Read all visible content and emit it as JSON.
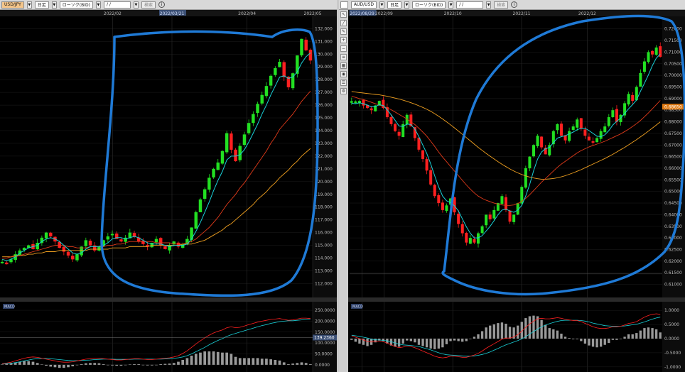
{
  "toolbar_left": {
    "symbol": "USD/JPY",
    "period": "日足",
    "chart_type": "ローソク(BID)",
    "date": " /  / ",
    "search_label": "検索"
  },
  "toolbar_right": {
    "symbol": "AUD/USD",
    "period": "日足",
    "chart_type": "ローソク(BID)",
    "date": " /  / ",
    "search_label": "検索"
  },
  "icons": {
    "info": "info-icon",
    "tools": [
      "cursor-icon",
      "line-icon",
      "pencil-icon",
      "zoom-in-icon",
      "zoom-out-icon",
      "fibonacci-icon",
      "grid-icon",
      "eye-icon",
      "layers-icon",
      "settings-icon"
    ]
  },
  "colors": {
    "bull": "#22e022",
    "bear": "#ff2020",
    "ma_short": "#19cfd6",
    "ma_mid": "#e03a1a",
    "ma_long": "#f0a020",
    "annotation": "#1f7ad6",
    "macd_hist": "#9a9a9a"
  },
  "chart_data": [
    {
      "type": "candlestick",
      "panel": "left",
      "symbol": "USD/JPY",
      "x_ticks": [
        "2022/02",
        "2022/03/21",
        "2022/04",
        "2022/05"
      ],
      "highlighted_date": "2022/03/21",
      "ylim": [
        111.3,
        132.8
      ],
      "y_ticks": [
        "112.000",
        "113.000",
        "114.000",
        "115.000",
        "116.000",
        "117.000",
        "118.000",
        "119.000",
        "120.000",
        "121.000",
        "122.000",
        "123.000",
        "124.000",
        "125.000",
        "126.000",
        "127.000",
        "128.000",
        "129.000",
        "130.000",
        "131.000",
        "132.000"
      ],
      "y_tick_values": [
        112,
        113,
        114,
        115,
        116,
        117,
        118,
        119,
        120,
        121,
        122,
        123,
        124,
        125,
        126,
        127,
        128,
        129,
        130,
        131,
        132
      ],
      "close_path": [
        113.7,
        113.6,
        113.9,
        114.3,
        114.6,
        114.8,
        115.0,
        114.7,
        115.2,
        115.6,
        116.0,
        115.7,
        115.3,
        114.8,
        114.5,
        114.2,
        113.9,
        114.3,
        114.9,
        115.4,
        115.0,
        114.6,
        114.9,
        115.4,
        115.7,
        115.9,
        115.5,
        115.3,
        115.6,
        116.0,
        115.7,
        115.3,
        115.1,
        114.9,
        115.2,
        115.5,
        115.0,
        114.7,
        115.0,
        115.3,
        114.9,
        115.1,
        115.5,
        116.4,
        117.6,
        118.6,
        119.4,
        120.3,
        121.0,
        121.5,
        122.4,
        123.8,
        122.5,
        121.6,
        122.8,
        123.7,
        124.6,
        125.3,
        126.1,
        126.8,
        127.5,
        128.3,
        128.9,
        129.4,
        128.2,
        127.4,
        128.5,
        129.9,
        131.2,
        130.3,
        129.5
      ],
      "ma_short": [
        113.9,
        113.8,
        113.9,
        114.1,
        114.4,
        114.6,
        114.8,
        114.9,
        115.0,
        115.3,
        115.5,
        115.6,
        115.5,
        115.3,
        115.0,
        114.7,
        114.4,
        114.3,
        114.4,
        114.7,
        114.9,
        114.9,
        114.9,
        115.0,
        115.2,
        115.5,
        115.6,
        115.6,
        115.5,
        115.6,
        115.7,
        115.6,
        115.4,
        115.2,
        115.1,
        115.1,
        115.1,
        115.0,
        114.9,
        115.0,
        115.0,
        115.0,
        115.1,
        115.5,
        116.1,
        116.8,
        117.6,
        118.4,
        119.3,
        120.1,
        120.8,
        121.7,
        122.0,
        122.0,
        122.1,
        122.5,
        123.1,
        123.8,
        124.5,
        125.3,
        126.0,
        126.8,
        127.5,
        128.2,
        128.3,
        128.1,
        128.2,
        128.6,
        129.3,
        129.8,
        130.1
      ],
      "ma_mid": [
        114.0,
        114.0,
        114.1,
        114.1,
        114.2,
        114.3,
        114.4,
        114.5,
        114.6,
        114.7,
        114.8,
        114.9,
        115.0,
        115.0,
        115.0,
        114.9,
        114.9,
        114.8,
        114.8,
        114.8,
        114.9,
        114.9,
        114.9,
        114.9,
        115.0,
        115.0,
        115.1,
        115.1,
        115.2,
        115.3,
        115.3,
        115.3,
        115.3,
        115.3,
        115.3,
        115.2,
        115.2,
        115.2,
        115.2,
        115.1,
        115.1,
        115.1,
        115.2,
        115.3,
        115.5,
        115.8,
        116.1,
        116.4,
        116.8,
        117.2,
        117.7,
        118.2,
        118.6,
        119.0,
        119.5,
        119.9,
        120.4,
        120.9,
        121.4,
        121.9,
        122.4,
        123.0,
        123.5,
        124.1,
        124.5,
        124.9,
        125.3,
        125.8,
        126.3,
        126.7,
        127.1
      ],
      "ma_long": [
        114.1,
        114.1,
        114.1,
        114.2,
        114.2,
        114.2,
        114.3,
        114.3,
        114.4,
        114.4,
        114.5,
        114.5,
        114.5,
        114.6,
        114.6,
        114.6,
        114.6,
        114.6,
        114.6,
        114.6,
        114.7,
        114.7,
        114.7,
        114.7,
        114.7,
        114.8,
        114.8,
        114.8,
        114.8,
        114.9,
        114.9,
        114.9,
        114.9,
        114.9,
        115.0,
        115.0,
        115.0,
        115.0,
        115.0,
        115.0,
        115.0,
        115.1,
        115.1,
        115.1,
        115.2,
        115.3,
        115.4,
        115.6,
        115.8,
        116.0,
        116.2,
        116.5,
        116.7,
        117.0,
        117.3,
        117.6,
        117.9,
        118.2,
        118.6,
        118.9,
        119.2,
        119.6,
        119.9,
        120.3,
        120.6,
        120.9,
        121.3,
        121.6,
        122.0,
        122.3,
        122.6
      ],
      "macd": {
        "label": "MACD",
        "ylim": [
          -20,
          260
        ],
        "y_ticks": [
          "0.0000",
          "50.0000",
          "100.0000",
          "150.0000",
          "200.0000",
          "250.0000"
        ],
        "y_tick_values": [
          0,
          50,
          100,
          150,
          200,
          250
        ],
        "current_label": "139.2360",
        "current_value": 125,
        "macd_line": [
          5,
          8,
          12,
          18,
          24,
          30,
          34,
          36,
          34,
          30,
          26,
          22,
          18,
          14,
          12,
          12,
          14,
          18,
          22,
          26,
          28,
          30,
          30,
          28,
          26,
          24,
          22,
          22,
          24,
          26,
          28,
          28,
          26,
          24,
          24,
          26,
          28,
          30,
          32,
          36,
          42,
          52,
          64,
          80,
          96,
          110,
          124,
          136,
          146,
          154,
          160,
          170,
          174,
          170,
          172,
          178,
          184,
          190,
          196,
          200,
          204,
          208,
          210,
          212,
          208,
          204,
          206,
          210,
          214,
          214,
          212
        ],
        "signal_line": [
          4,
          5,
          7,
          10,
          14,
          18,
          22,
          26,
          28,
          29,
          29,
          28,
          26,
          24,
          22,
          20,
          19,
          19,
          20,
          21,
          22,
          24,
          25,
          26,
          26,
          26,
          25,
          25,
          25,
          25,
          26,
          26,
          26,
          26,
          26,
          26,
          26,
          27,
          28,
          30,
          32,
          36,
          42,
          50,
          60,
          70,
          80,
          92,
          102,
          112,
          120,
          130,
          138,
          144,
          150,
          156,
          162,
          168,
          174,
          180,
          184,
          190,
          194,
          198,
          200,
          202,
          202,
          204,
          206,
          208,
          210
        ]
      }
    },
    {
      "type": "candlestick",
      "panel": "right",
      "symbol": "AUD/USD",
      "x_ticks": [
        "2022/08/29",
        "2022/09",
        "2022/10",
        "2022/11",
        "2022/12"
      ],
      "highlighted_date": "2022/08/29",
      "ylim": [
        0.6065,
        0.7245
      ],
      "y_ticks": [
        "0.61000",
        "0.61500",
        "0.62000",
        "0.62500",
        "0.63000",
        "0.63500",
        "0.64000",
        "0.64500",
        "0.65000",
        "0.65500",
        "0.66000",
        "0.66500",
        "0.67000",
        "0.67500",
        "0.68000",
        "0.68500",
        "0.69000",
        "0.69500",
        "0.70000",
        "0.70500",
        "0.71000",
        "0.71500",
        "0.72000"
      ],
      "y_tick_values": [
        0.61,
        0.615,
        0.62,
        0.625,
        0.63,
        0.635,
        0.64,
        0.645,
        0.65,
        0.655,
        0.66,
        0.665,
        0.67,
        0.675,
        0.68,
        0.685,
        0.69,
        0.695,
        0.7,
        0.705,
        0.71,
        0.715,
        0.72
      ],
      "current_label": "0.68650",
      "current_value": 0.6865,
      "close_path": [
        0.6885,
        0.688,
        0.689,
        0.687,
        0.686,
        0.685,
        0.687,
        0.689,
        0.686,
        0.682,
        0.679,
        0.676,
        0.674,
        0.679,
        0.683,
        0.678,
        0.673,
        0.668,
        0.664,
        0.659,
        0.653,
        0.648,
        0.645,
        0.642,
        0.644,
        0.647,
        0.641,
        0.636,
        0.632,
        0.628,
        0.63,
        0.628,
        0.632,
        0.635,
        0.64,
        0.638,
        0.642,
        0.645,
        0.648,
        0.642,
        0.637,
        0.64,
        0.645,
        0.652,
        0.66,
        0.665,
        0.67,
        0.674,
        0.669,
        0.666,
        0.67,
        0.676,
        0.679,
        0.674,
        0.672,
        0.676,
        0.678,
        0.681,
        0.677,
        0.674,
        0.672,
        0.671,
        0.673,
        0.676,
        0.678,
        0.682,
        0.685,
        0.68,
        0.683,
        0.688,
        0.692,
        0.689,
        0.695,
        0.701,
        0.706,
        0.71,
        0.709,
        0.712,
        0.708
      ],
      "ma_short": [
        0.688,
        0.6878,
        0.6882,
        0.6878,
        0.6872,
        0.6864,
        0.6866,
        0.6874,
        0.687,
        0.6852,
        0.683,
        0.6806,
        0.6782,
        0.678,
        0.679,
        0.6788,
        0.6768,
        0.6736,
        0.67,
        0.6664,
        0.6618,
        0.6568,
        0.652,
        0.648,
        0.646,
        0.6452,
        0.6438,
        0.6416,
        0.6382,
        0.6348,
        0.632,
        0.63,
        0.63,
        0.631,
        0.633,
        0.635,
        0.6374,
        0.64,
        0.642,
        0.6424,
        0.6416,
        0.641,
        0.642,
        0.644,
        0.648,
        0.653,
        0.659,
        0.664,
        0.667,
        0.6684,
        0.669,
        0.671,
        0.673,
        0.6736,
        0.674,
        0.6748,
        0.6756,
        0.6766,
        0.6772,
        0.6772,
        0.6762,
        0.675,
        0.6738,
        0.6736,
        0.6744,
        0.6762,
        0.6786,
        0.6802,
        0.6816,
        0.6836,
        0.6856,
        0.6874,
        0.6894,
        0.6932,
        0.6966,
        0.7002,
        0.7042,
        0.7074,
        0.7092
      ],
      "ma_mid": [
        0.691,
        0.6905,
        0.69,
        0.6896,
        0.689,
        0.6884,
        0.6878,
        0.6872,
        0.6866,
        0.686,
        0.6852,
        0.6842,
        0.6832,
        0.6822,
        0.6812,
        0.68,
        0.6788,
        0.6772,
        0.6756,
        0.6738,
        0.6716,
        0.6694,
        0.667,
        0.6648,
        0.6628,
        0.6608,
        0.6588,
        0.6568,
        0.6548,
        0.6528,
        0.651,
        0.6494,
        0.648,
        0.647,
        0.6462,
        0.6456,
        0.645,
        0.6446,
        0.6442,
        0.644,
        0.644,
        0.6442,
        0.6448,
        0.6458,
        0.647,
        0.6486,
        0.6504,
        0.6522,
        0.654,
        0.6556,
        0.6572,
        0.6588,
        0.6604,
        0.6618,
        0.663,
        0.6642,
        0.6654,
        0.6666,
        0.6676,
        0.6684,
        0.6692,
        0.6698,
        0.6704,
        0.671,
        0.6716,
        0.6724,
        0.6732,
        0.674,
        0.6748,
        0.6758,
        0.6768,
        0.678,
        0.6792,
        0.6806,
        0.6822,
        0.6838,
        0.6856,
        0.6874,
        0.6892
      ],
      "ma_long": [
        0.693,
        0.6928,
        0.6926,
        0.6924,
        0.6922,
        0.692,
        0.6918,
        0.6916,
        0.6913,
        0.691,
        0.6906,
        0.6902,
        0.6898,
        0.6893,
        0.6888,
        0.6882,
        0.6876,
        0.6869,
        0.6862,
        0.6854,
        0.6845,
        0.6835,
        0.6824,
        0.6812,
        0.68,
        0.6787,
        0.6774,
        0.676,
        0.6746,
        0.6732,
        0.6718,
        0.6704,
        0.669,
        0.6677,
        0.6664,
        0.6652,
        0.664,
        0.6628,
        0.6617,
        0.6607,
        0.6597,
        0.6588,
        0.658,
        0.6573,
        0.6567,
        0.6562,
        0.6558,
        0.6555,
        0.6553,
        0.6553,
        0.6554,
        0.6556,
        0.6559,
        0.6563,
        0.6568,
        0.6574,
        0.658,
        0.6587,
        0.6594,
        0.6602,
        0.661,
        0.6618,
        0.6626,
        0.6634,
        0.6642,
        0.6651,
        0.666,
        0.667,
        0.668,
        0.669,
        0.6701,
        0.6712,
        0.6723,
        0.6735,
        0.6747,
        0.676,
        0.6773,
        0.6786,
        0.68
      ],
      "macd": {
        "label": "MACD",
        "ylim": [
          -1.08,
          1.08
        ],
        "y_ticks": [
          "1.0000",
          "0.5000",
          "0.0000",
          "-0.5000",
          "-1.0000"
        ],
        "y_tick_values": [
          1.0,
          0.5,
          0.0,
          -0.5,
          -1.0
        ],
        "macd_line": [
          0.1,
          0.05,
          0.0,
          -0.05,
          -0.1,
          -0.12,
          -0.1,
          -0.08,
          -0.1,
          -0.16,
          -0.22,
          -0.28,
          -0.32,
          -0.3,
          -0.26,
          -0.28,
          -0.32,
          -0.38,
          -0.44,
          -0.5,
          -0.56,
          -0.62,
          -0.66,
          -0.68,
          -0.66,
          -0.62,
          -0.62,
          -0.64,
          -0.66,
          -0.66,
          -0.62,
          -0.58,
          -0.52,
          -0.44,
          -0.34,
          -0.26,
          -0.18,
          -0.1,
          -0.02,
          0.02,
          0.02,
          0.06,
          0.14,
          0.26,
          0.4,
          0.52,
          0.62,
          0.7,
          0.72,
          0.7,
          0.7,
          0.72,
          0.74,
          0.72,
          0.68,
          0.66,
          0.64,
          0.64,
          0.6,
          0.54,
          0.48,
          0.42,
          0.38,
          0.36,
          0.36,
          0.38,
          0.42,
          0.42,
          0.44,
          0.48,
          0.54,
          0.56,
          0.6,
          0.68,
          0.76,
          0.82,
          0.86,
          0.88,
          0.86
        ],
        "signal_line": [
          0.12,
          0.1,
          0.08,
          0.05,
          0.02,
          -0.02,
          -0.04,
          -0.05,
          -0.06,
          -0.08,
          -0.11,
          -0.15,
          -0.19,
          -0.22,
          -0.23,
          -0.24,
          -0.26,
          -0.28,
          -0.32,
          -0.36,
          -0.4,
          -0.45,
          -0.5,
          -0.54,
          -0.57,
          -0.58,
          -0.59,
          -0.6,
          -0.61,
          -0.62,
          -0.62,
          -0.61,
          -0.59,
          -0.56,
          -0.52,
          -0.47,
          -0.41,
          -0.35,
          -0.28,
          -0.22,
          -0.17,
          -0.12,
          -0.07,
          -0.01,
          0.07,
          0.16,
          0.25,
          0.34,
          0.42,
          0.48,
          0.53,
          0.57,
          0.61,
          0.64,
          0.65,
          0.65,
          0.65,
          0.65,
          0.64,
          0.62,
          0.59,
          0.55,
          0.52,
          0.49,
          0.46,
          0.45,
          0.44,
          0.44,
          0.44,
          0.45,
          0.47,
          0.49,
          0.51,
          0.55,
          0.59,
          0.64,
          0.69,
          0.73,
          0.76
        ]
      }
    }
  ]
}
